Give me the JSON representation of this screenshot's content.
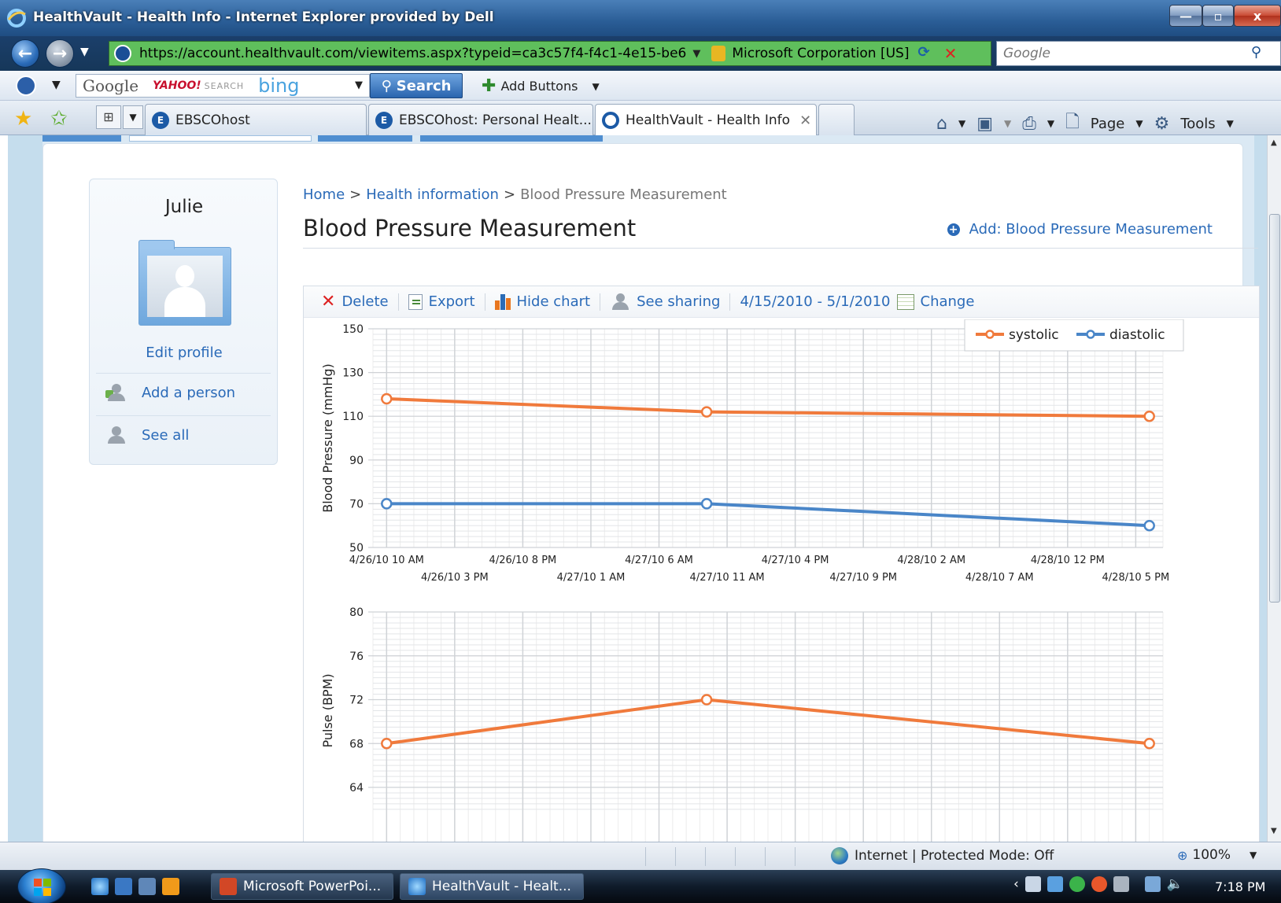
{
  "window": {
    "title": "HealthVault - Health Info - Internet Explorer provided by Dell",
    "minimize_label": "—",
    "maximize_label": "▫",
    "close_label": "x"
  },
  "addressbar": {
    "url": "https://account.healthvault.com/viewitems.aspx?typeid=ca3c57f4-f4c1-4e15-be6",
    "certificate": "Microsoft Corporation [US]",
    "search_placeholder": "Google"
  },
  "toolbar": {
    "google": "Google",
    "yahoo": "YAHOO!",
    "yahoo_search": "SEARCH",
    "bing": "bing",
    "search_label": "Search",
    "add_buttons": "Add Buttons"
  },
  "tabs": [
    {
      "label": "EBSCOhost",
      "icon": "E"
    },
    {
      "label": "EBSCOhost: Personal Healt...",
      "icon": "E"
    },
    {
      "label": "HealthVault - Health Info",
      "icon": "",
      "close": "✕"
    }
  ],
  "command_bar": {
    "page_label": "Page",
    "tools_label": "Tools"
  },
  "sidebar": {
    "name": "Julie",
    "edit_profile": "Edit profile",
    "items": [
      {
        "label": "Add a person"
      },
      {
        "label": "See all"
      }
    ]
  },
  "breadcrumb": {
    "home": "Home",
    "health_info": "Health information",
    "current": "Blood Pressure Measurement",
    "separator": ">"
  },
  "page": {
    "title": "Blood Pressure Measurement",
    "add_link": "Add: Blood Pressure Measurement"
  },
  "chart_toolbar": {
    "delete": "Delete",
    "export": "Export",
    "hide_chart": "Hide chart",
    "see_sharing": "See sharing",
    "date_range": "4/15/2010 - 5/1/2010",
    "change": "Change"
  },
  "chart_data": [
    {
      "type": "line",
      "title": "",
      "ylabel": "Blood Pressure (mmHg)",
      "ylim": [
        50,
        150
      ],
      "yticks": [
        50,
        70,
        90,
        110,
        130,
        150
      ],
      "x_axis": "datetime",
      "xlim": [
        "2010-04-26T09:00",
        "2010-04-28T19:00"
      ],
      "xtick_labels": [
        {
          "t": "2010-04-26T10:00",
          "label": "4/26/10 10 AM",
          "row": 0
        },
        {
          "t": "2010-04-26T15:00",
          "label": "4/26/10 3 PM",
          "row": 1
        },
        {
          "t": "2010-04-26T20:00",
          "label": "4/26/10 8 PM",
          "row": 0
        },
        {
          "t": "2010-04-27T01:00",
          "label": "4/27/10 1 AM",
          "row": 1
        },
        {
          "t": "2010-04-27T06:00",
          "label": "4/27/10 6 AM",
          "row": 0
        },
        {
          "t": "2010-04-27T11:00",
          "label": "4/27/10 11 AM",
          "row": 1
        },
        {
          "t": "2010-04-27T16:00",
          "label": "4/27/10 4 PM",
          "row": 0
        },
        {
          "t": "2010-04-27T21:00",
          "label": "4/27/10 9 PM",
          "row": 1
        },
        {
          "t": "2010-04-28T02:00",
          "label": "4/28/10 2 AM",
          "row": 0
        },
        {
          "t": "2010-04-28T07:00",
          "label": "4/28/10 7 AM",
          "row": 1
        },
        {
          "t": "2010-04-28T12:00",
          "label": "4/28/10 12 PM",
          "row": 0
        },
        {
          "t": "2010-04-28T17:00",
          "label": "4/28/10 5 PM",
          "row": 1
        }
      ],
      "legend": "top-right",
      "grid": true,
      "series": [
        {
          "name": "systolic",
          "color": "#f07a3c",
          "points": [
            [
              "2010-04-26T10:00",
              118
            ],
            [
              "2010-04-27T09:30",
              112
            ],
            [
              "2010-04-28T18:00",
              110
            ]
          ]
        },
        {
          "name": "diastolic",
          "color": "#4a86c8",
          "points": [
            [
              "2010-04-26T10:00",
              70
            ],
            [
              "2010-04-27T09:30",
              70
            ],
            [
              "2010-04-28T18:00",
              60
            ]
          ]
        }
      ]
    },
    {
      "type": "line",
      "title": "",
      "ylabel": "Pulse (BPM)",
      "ylim": [
        62,
        80
      ],
      "yticks": [
        64,
        68,
        72,
        76,
        80
      ],
      "x_axis": "datetime",
      "xlim": [
        "2010-04-26T09:00",
        "2010-04-28T19:00"
      ],
      "grid": true,
      "series": [
        {
          "name": "",
          "color": "#f07a3c",
          "points": [
            [
              "2010-04-26T10:00",
              68
            ],
            [
              "2010-04-27T09:30",
              72
            ],
            [
              "2010-04-28T18:00",
              68
            ]
          ]
        }
      ]
    }
  ],
  "statusbar": {
    "zone": "Internet | Protected Mode: Off",
    "zoom": "100%"
  },
  "taskbar": {
    "items": [
      {
        "label": "Microsoft PowerPoi..."
      },
      {
        "label": "HealthVault - Healt..."
      }
    ],
    "clock": "7:18 PM"
  }
}
